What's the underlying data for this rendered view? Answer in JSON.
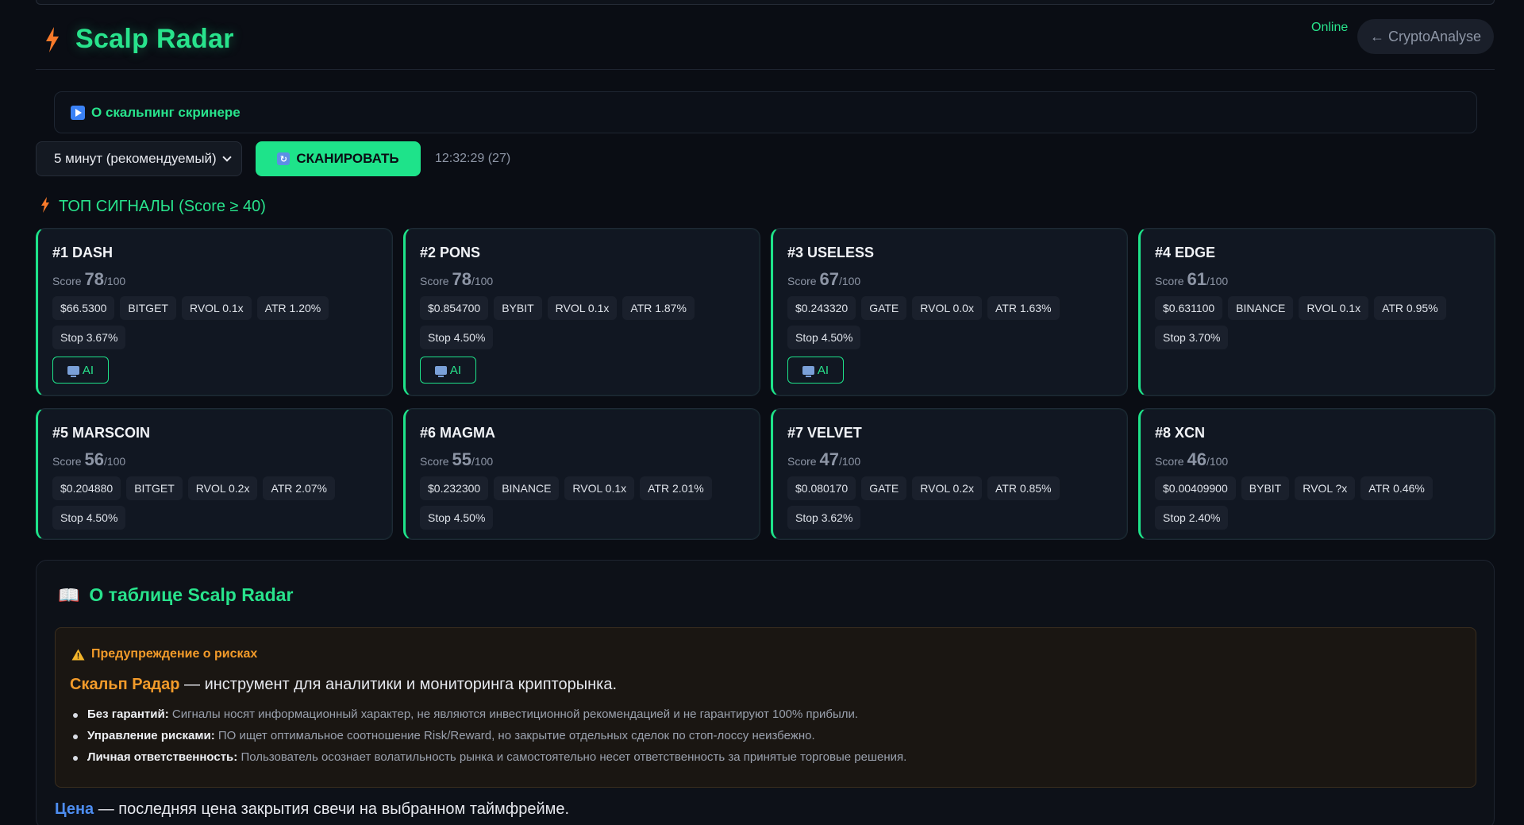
{
  "header": {
    "title": "Scalp Radar",
    "status": "Online",
    "back_label": "← CryptoAnalyse"
  },
  "info_bar": {
    "label": "О скальпинг скринере"
  },
  "controls": {
    "timeframe": "5 минут (рекомендуемый)",
    "scan_label": "СКАНИРОВАТЬ",
    "scan_time": "12:32:29 (27)"
  },
  "signals": {
    "title": "ТОП СИГНАЛЫ (Score ≥ 40)",
    "score_label": "Score",
    "score_suffix": "/100",
    "ai_label": "AI",
    "cards": [
      {
        "title": "#1 DASH",
        "score": "78",
        "price": "$66.5300",
        "exchange": "BITGET",
        "rvol": "RVOL 0.1x",
        "atr": "ATR 1.20%",
        "stop": "Stop 3.67%"
      },
      {
        "title": "#2 PONS",
        "score": "78",
        "price": "$0.854700",
        "exchange": "BYBIT",
        "rvol": "RVOL 0.1x",
        "atr": "ATR 1.87%",
        "stop": "Stop 4.50%"
      },
      {
        "title": "#3 USELESS",
        "score": "67",
        "price": "$0.243320",
        "exchange": "GATE",
        "rvol": "RVOL 0.0x",
        "atr": "ATR 1.63%",
        "stop": "Stop 4.50%"
      },
      {
        "title": "#4 EDGE",
        "score": "61",
        "price": "$0.631100",
        "exchange": "BINANCE",
        "rvol": "RVOL 0.1x",
        "atr": "ATR 0.95%",
        "stop": "Stop 3.70%"
      },
      {
        "title": "#5 MARSCOIN",
        "score": "56",
        "price": "$0.204880",
        "exchange": "BITGET",
        "rvol": "RVOL 0.2x",
        "atr": "ATR 2.07%",
        "stop": "Stop 4.50%"
      },
      {
        "title": "#6 MAGMA",
        "score": "55",
        "price": "$0.232300",
        "exchange": "BINANCE",
        "rvol": "RVOL 0.1x",
        "atr": "ATR 2.01%",
        "stop": "Stop 4.50%"
      },
      {
        "title": "#7 VELVET",
        "score": "47",
        "price": "$0.080170",
        "exchange": "GATE",
        "rvol": "RVOL 0.2x",
        "atr": "ATR 0.85%",
        "stop": "Stop 3.62%"
      },
      {
        "title": "#8 XCN",
        "score": "46",
        "price": "$0.00409900",
        "exchange": "BYBIT",
        "rvol": "RVOL ?x",
        "atr": "ATR 0.46%",
        "stop": "Stop 2.40%"
      }
    ]
  },
  "about": {
    "title": "О таблице Scalp Radar",
    "warning_title": "Предупреждение о рисках",
    "brand": "Скальп Радар",
    "intro_rest": " — инструмент для аналитики и мониторинга крипторынка.",
    "items": [
      {
        "bold": "Без гарантий:",
        "text": " Сигналы носят информационный характер, не являются инвестиционной рекомендацией и не гарантируют 100% прибыли."
      },
      {
        "bold": "Управление рисками:",
        "text": " ПО ищет оптимальное соотношение Risk/Reward, но закрытие отдельных сделок по стоп-лоссу неизбежно."
      },
      {
        "bold": "Личная ответственность:",
        "text": " Пользователь осознает волатильность рынка и самостоятельно несет ответственность за принятые торговые решения."
      }
    ],
    "price_label": "Цена",
    "price_text": " — последняя цена закрытия свечи на выбранном таймфрейме."
  }
}
